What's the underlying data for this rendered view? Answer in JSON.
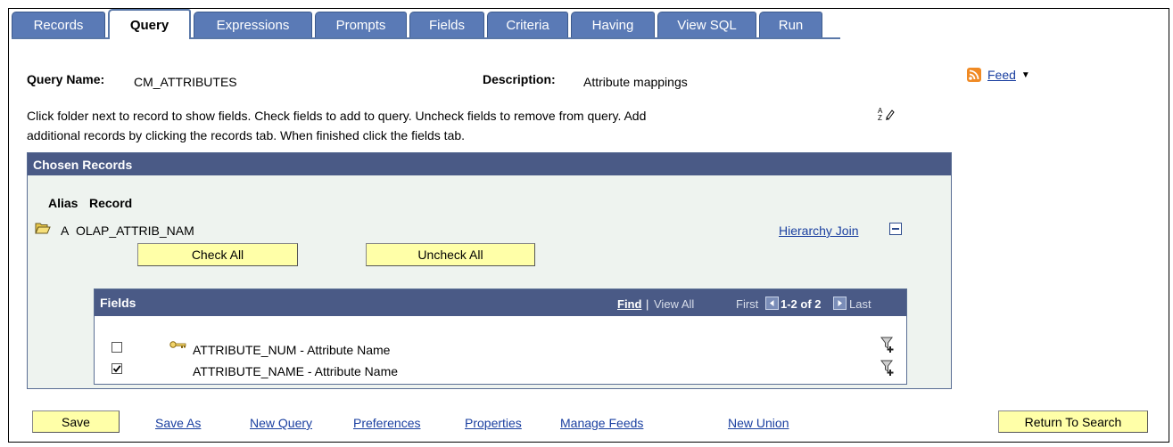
{
  "tabs": [
    {
      "label": "Records",
      "active": false
    },
    {
      "label": "Query",
      "active": true
    },
    {
      "label": "Expressions",
      "active": false
    },
    {
      "label": "Prompts",
      "active": false
    },
    {
      "label": "Fields",
      "active": false
    },
    {
      "label": "Criteria",
      "active": false
    },
    {
      "label": "Having",
      "active": false
    },
    {
      "label": "View SQL",
      "active": false
    },
    {
      "label": "Run",
      "active": false
    }
  ],
  "query": {
    "name_label": "Query Name:",
    "name_value": "CM_ATTRIBUTES",
    "desc_label": "Description:",
    "desc_value": "Attribute mappings"
  },
  "feed": {
    "label": "Feed"
  },
  "instructions": {
    "line1": "Click folder next to record to show fields. Check fields to add to query. Uncheck fields to remove from query. Add",
    "line2": "additional records by clicking the records tab. When finished click the fields tab."
  },
  "chosen_records": {
    "title": "Chosen Records",
    "col_alias": "Alias",
    "col_record": "Record",
    "record": {
      "alias": "A",
      "name": "OLAP_ATTRIB_NAM"
    },
    "hierarchy_join": "Hierarchy Join",
    "check_all": "Check All",
    "uncheck_all": "Uncheck All"
  },
  "fields_grid": {
    "title": "Fields",
    "find": "Find",
    "separator": "|",
    "view_all": "View All",
    "first": "First",
    "range": "1-2 of 2",
    "last": "Last",
    "rows": [
      {
        "label": "ATTRIBUTE_NUM - Attribute Name",
        "checked": false,
        "key": true
      },
      {
        "label": "ATTRIBUTE_NAME - Attribute Name",
        "checked": true,
        "key": false
      }
    ]
  },
  "footer": {
    "save": "Save",
    "save_as": "Save As",
    "new_query": "New Query",
    "preferences": "Preferences",
    "properties": "Properties",
    "manage_feeds": "Manage Feeds",
    "new_union": "New Union",
    "return_to_search": "Return To Search"
  },
  "colors": {
    "tab_bg": "#5a7ab6",
    "panel_header": "#4a5a86",
    "panel_bg": "#eef3ef",
    "button_bg": "#ffffa8",
    "link": "#1a3fa0",
    "feed_icon": "#f08a24"
  }
}
